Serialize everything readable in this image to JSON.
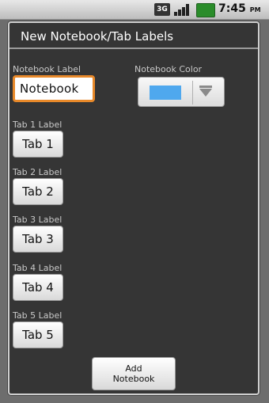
{
  "status_bar": {
    "network": "3G",
    "time": "7:45",
    "ampm": "PM"
  },
  "dialog": {
    "title": "New Notebook/Tab Labels",
    "notebook_label_heading": "Notebook Label",
    "notebook_label_value": "Notebook",
    "notebook_color_heading": "Notebook Color",
    "notebook_color": "#4fa8ee",
    "tabs": [
      {
        "heading": "Tab 1 Label",
        "value": "Tab 1"
      },
      {
        "heading": "Tab 2 Label",
        "value": "Tab 2"
      },
      {
        "heading": "Tab 3 Label",
        "value": "Tab 3"
      },
      {
        "heading": "Tab 4 Label",
        "value": "Tab 4"
      },
      {
        "heading": "Tab 5 Label",
        "value": "Tab 5"
      }
    ],
    "add_button_line1": "Add",
    "add_button_line2": "Notebook"
  },
  "colors": {
    "accent_focus": "#e8892a",
    "swatch": "#4fa8ee"
  }
}
